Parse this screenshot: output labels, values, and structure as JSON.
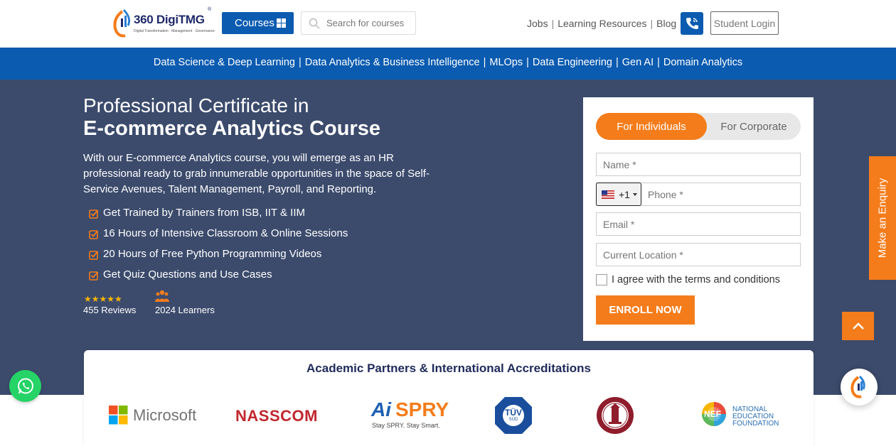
{
  "brand": {
    "name": "360 DigiTMG",
    "tagline": "Digital Transformation · Management · Governance",
    "registered": "®"
  },
  "header": {
    "courses_label": "Courses",
    "search_placeholder": "Search for courses",
    "links": [
      "Jobs",
      "Learning Resources",
      "Blog"
    ],
    "separator": "|",
    "login_label": "Student Login"
  },
  "nav": {
    "items": [
      "Data Science & Deep Learning",
      "Data Analytics & Business Intelligence",
      "MLOps",
      "Data Engineering",
      "Gen AI",
      "Domain Analytics"
    ]
  },
  "hero": {
    "title_line1": "Professional Certificate in",
    "title_line2": "E-commerce Analytics Course",
    "description": "With our E-commerce Analytics course, you will emerge as an HR professional ready to grab innumerable opportunities in the space of Self-Service Avenues, Talent Management, Payroll, and Reporting.",
    "features": [
      "Get Trained by Trainers from ISB, IIT & IIM",
      "16 Hours of Intensive Classroom & Online Sessions",
      "20 Hours of Free Python Programming Videos",
      "Get Quiz Questions and Use Cases"
    ],
    "rating_stars": "★★★★★",
    "rating": 5,
    "reviews": "455 Reviews",
    "learners": "2024 Learners"
  },
  "form": {
    "tab_individuals": "For Individuals",
    "tab_corporate": "For Corporate",
    "name_placeholder": "Name *",
    "country_code": "+1",
    "phone_placeholder": "Phone *",
    "email_placeholder": "Email *",
    "location_placeholder": "Current Location *",
    "agree_label": "I agree with the terms and conditions",
    "enroll_label": "ENROLL NOW"
  },
  "side": {
    "enquiry_label": "Make an Enquiry"
  },
  "partners": {
    "heading": "Academic Partners & International Accreditations",
    "logos": {
      "microsoft": "Microsoft",
      "nasscom": "NASSCOM",
      "aispry_ai": "Ai",
      "aispry_spry": "SPRY",
      "aispry_tag": "Stay SPRY. Stay Smart.",
      "tuv": "TÜV",
      "tuv_sub": "SÜD",
      "nef": "NEF",
      "nef_line1": "NATIONAL",
      "nef_line2": "EDUCATION",
      "nef_line3": "FOUNDATION"
    }
  },
  "colors": {
    "primary_blue": "#0b5bb0",
    "hero_bg": "#3c4b6c",
    "accent_orange": "#f47c1b",
    "whatsapp_green": "#25d366"
  }
}
